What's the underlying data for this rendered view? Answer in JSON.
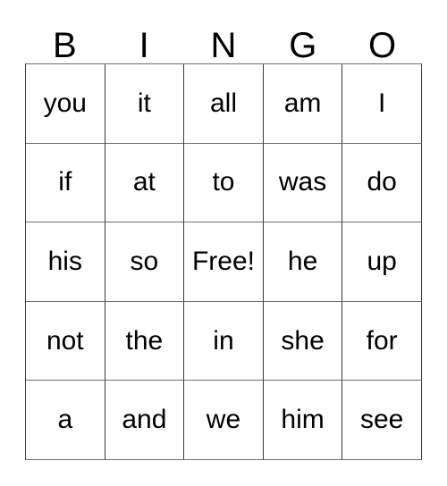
{
  "card": {
    "header": {
      "letters": [
        "B",
        "I",
        "N",
        "G",
        "O"
      ]
    },
    "colors": {
      "background": "#ffffff",
      "text": "#000000",
      "grid_line_vertical": "#3a3a3a",
      "grid_line_horizontal": "#6e6e6e"
    },
    "grid": {
      "columns": 5,
      "rows": 5,
      "free_space": "Free!",
      "cells": [
        [
          "you",
          "it",
          "all",
          "am",
          "I"
        ],
        [
          "if",
          "at",
          "to",
          "was",
          "do"
        ],
        [
          "his",
          "so",
          "Free!",
          "he",
          "up"
        ],
        [
          "not",
          "the",
          "in",
          "she",
          "for"
        ],
        [
          "a",
          "and",
          "we",
          "him",
          "see"
        ]
      ]
    }
  }
}
